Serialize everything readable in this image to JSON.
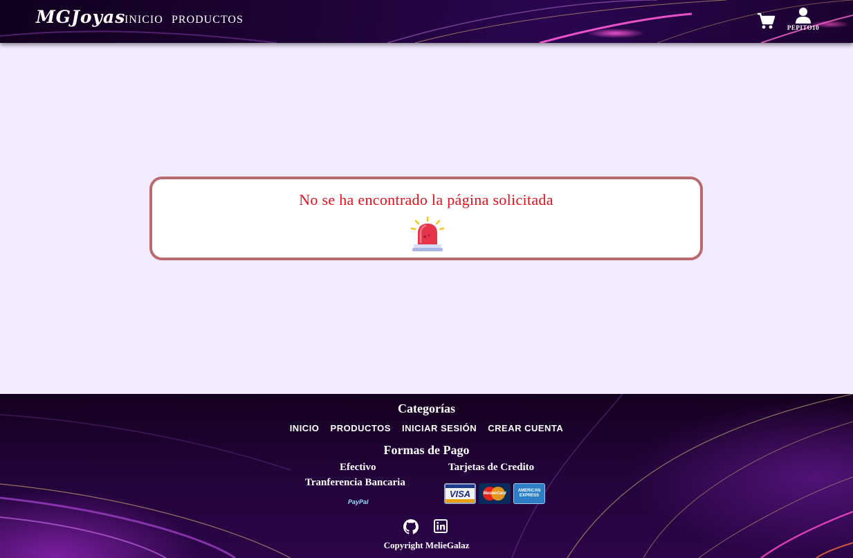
{
  "header": {
    "logo": "MGJoyas",
    "nav": {
      "inicio": "INICIO",
      "productos": "PRODUCTOS"
    },
    "cart_icon": "shopping-cart-icon",
    "user_icon": "user-icon",
    "username": "PEPITO10"
  },
  "main": {
    "error_message": "No se ha encontrado la página solicitada",
    "alert_icon": "siren-icon"
  },
  "footer": {
    "categories_title": "Categorías",
    "links": [
      "INICIO",
      "PRODUCTOS",
      "INICIAR SESIÓN",
      "CREAR CUENTA"
    ],
    "payment_title": "Formas de Pago",
    "efectivo": "Efectivo",
    "tarjetas": "Tarjetas de Credito",
    "transferencia": "Tranferencia Bancaria",
    "paypal": "PayPal",
    "card_logos": {
      "visa": "VISA",
      "mastercard": "MasterCard",
      "amex": "AMERICAN EXPRESS"
    },
    "social_icons": [
      "github-icon",
      "linkedin-icon"
    ],
    "copyright": "Copyright MelieGalaz"
  },
  "colors": {
    "page_background": "#f3ebff",
    "header_background": "#1d0335",
    "card_border": "#b96a6e",
    "error_text": "#e3101d"
  }
}
